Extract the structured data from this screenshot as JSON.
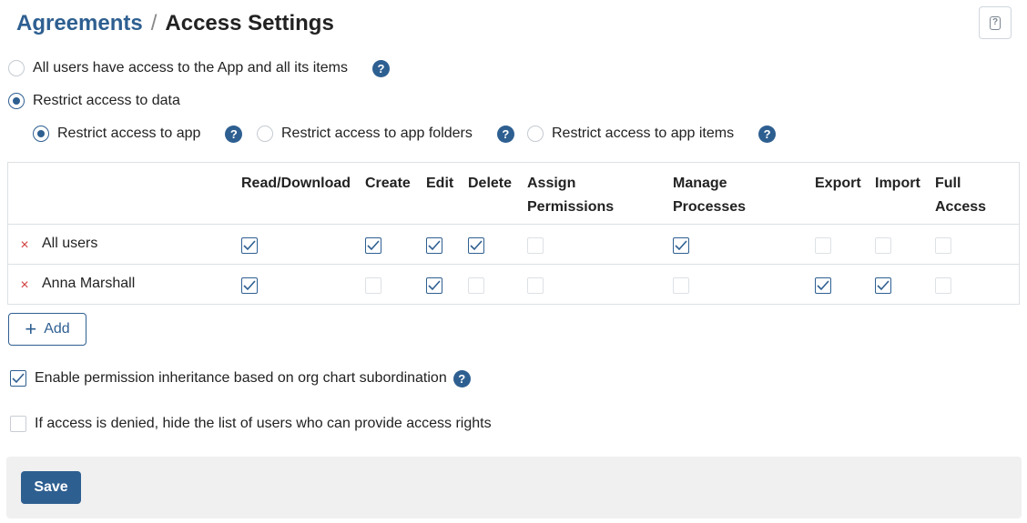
{
  "breadcrumb": {
    "parent": "Agreements",
    "separator": "/",
    "current": "Access Settings"
  },
  "help_icon": "question-box-icon",
  "access_mode": {
    "options": [
      {
        "label": "All users have access to the App and all its items",
        "selected": false
      },
      {
        "label": "Restrict access to data",
        "selected": true
      }
    ]
  },
  "restrict_scope": {
    "options": [
      {
        "label": "Restrict access to app",
        "selected": true
      },
      {
        "label": "Restrict access to app folders",
        "selected": false
      },
      {
        "label": "Restrict access to app items",
        "selected": false
      }
    ]
  },
  "help_glyph": "?",
  "table": {
    "columns": [
      "Read/Download",
      "Create",
      "Edit",
      "Delete",
      "Assign Permissions",
      "Manage Processes",
      "Export",
      "Import",
      "Full Access"
    ],
    "rows": [
      {
        "name": "All users",
        "delete_glyph": "×",
        "perms": [
          true,
          true,
          true,
          true,
          false,
          true,
          false,
          false,
          false
        ],
        "disabled": [
          false,
          false,
          false,
          false,
          true,
          false,
          true,
          true,
          true
        ]
      },
      {
        "name": "Anna Marshall",
        "delete_glyph": "×",
        "perms": [
          true,
          false,
          true,
          false,
          false,
          false,
          true,
          true,
          false
        ],
        "disabled": [
          false,
          true,
          false,
          true,
          true,
          true,
          false,
          false,
          true
        ]
      }
    ]
  },
  "add_button": {
    "label": "Add",
    "icon": "+"
  },
  "options": {
    "inheritance": {
      "label": "Enable permission inheritance based on org chart subordination",
      "checked": true
    },
    "hide_users": {
      "label": "If access is denied, hide the list of users who can provide access rights",
      "checked": false
    }
  },
  "footer": {
    "save_label": "Save"
  },
  "colors": {
    "accent": "#2e5f91",
    "danger": "#d14040",
    "footer_bg": "#f0f0f0"
  }
}
